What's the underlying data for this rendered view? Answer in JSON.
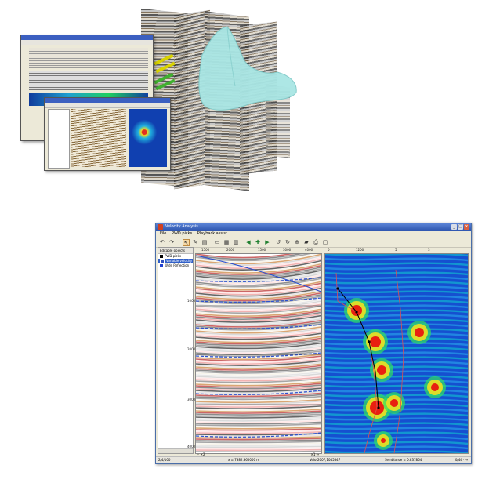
{
  "window": {
    "title": "Velocity Analysis",
    "menu": [
      "File",
      "PWD picks",
      "Playback assist"
    ],
    "panel_header": "Editable objects",
    "objects": [
      {
        "label": "PWD picks",
        "color": "#000000",
        "selected": false
      },
      {
        "label": "Variable velocity",
        "color": "#3050c0",
        "selected": true
      },
      {
        "label": "Wide Reflection",
        "color": "#2040d0",
        "selected": false
      }
    ],
    "gather_ticks": [
      "1500",
      "2000",
      "1500",
      "3000",
      "4000"
    ],
    "semb_ticks": [
      "0",
      "1200",
      "5",
      "3"
    ],
    "time_ticks": [
      "1000",
      "2000",
      "3000",
      "4000"
    ],
    "gather_bottom_left": "← ×2",
    "gather_bottom_right": "×1 →",
    "status": {
      "left": "2/4/100",
      "x": "x = 7382.360000 m",
      "v": "Velo(2007,1045847",
      "semb": "Semblance = 0.837864",
      "right": "0/44 · →"
    }
  },
  "colors": {
    "title_bar": "#2f56b0",
    "selection": "#3160c8",
    "pick_line": "#2a4fd0",
    "velocity_curve": "#e05050"
  },
  "icons": [
    "undo-icon",
    "redo-icon",
    "pointer-icon",
    "pick-icon",
    "open-icon",
    "save-icon",
    "back-icon",
    "forward-icon",
    "zoom-icon",
    "print-icon"
  ]
}
